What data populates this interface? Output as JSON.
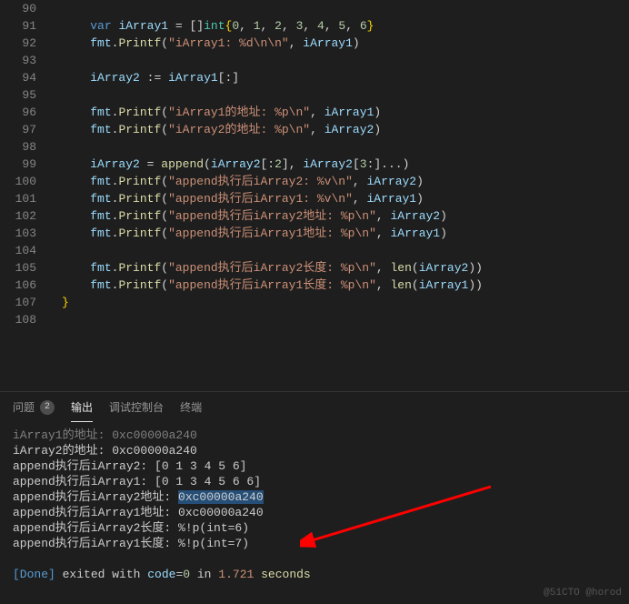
{
  "editor": {
    "lines": [
      {
        "n": 90,
        "html": ""
      },
      {
        "n": 91,
        "html": "    <span class='kw2'>var</span> <span class='ident'>iArray1</span> <span class='op'>=</span> <span class='op'>[]</span><span class='type'>int</span><span class='brace'>{</span><span class='num'>0</span>, <span class='num'>1</span>, <span class='num'>2</span>, <span class='num'>3</span>, <span class='num'>4</span>, <span class='num'>5</span>, <span class='num'>6</span><span class='brace'>}</span>"
      },
      {
        "n": 92,
        "html": "    <span class='ident'>fmt</span>.<span class='func'>Printf</span>(<span class='str'>\"iArray1: %d\\n\\n\"</span>, <span class='ident'>iArray1</span>)"
      },
      {
        "n": 93,
        "html": ""
      },
      {
        "n": 94,
        "html": "    <span class='ident'>iArray2</span> <span class='op'>:=</span> <span class='ident'>iArray1</span>[:]"
      },
      {
        "n": 95,
        "html": ""
      },
      {
        "n": 96,
        "html": "    <span class='ident'>fmt</span>.<span class='func'>Printf</span>(<span class='str'>\"iArray1的地址: %p\\n\"</span>, <span class='ident'>iArray1</span>)"
      },
      {
        "n": 97,
        "html": "    <span class='ident'>fmt</span>.<span class='func'>Printf</span>(<span class='str'>\"iArray2的地址: %p\\n\"</span>, <span class='ident'>iArray2</span>)"
      },
      {
        "n": 98,
        "html": ""
      },
      {
        "n": 99,
        "html": "    <span class='ident'>iArray2</span> <span class='op'>=</span> <span class='func'>append</span>(<span class='ident'>iArray2</span>[:<span class='num'>2</span>], <span class='ident'>iArray2</span>[<span class='num'>3</span>:]<span class='op'>...</span>)"
      },
      {
        "n": 100,
        "html": "    <span class='ident'>fmt</span>.<span class='func'>Printf</span>(<span class='str'>\"append执行后iArray2: %v\\n\"</span>, <span class='ident'>iArray2</span>)"
      },
      {
        "n": 101,
        "html": "    <span class='ident'>fmt</span>.<span class='func'>Printf</span>(<span class='str'>\"append执行后iArray1: %v\\n\"</span>, <span class='ident'>iArray1</span>)"
      },
      {
        "n": 102,
        "html": "    <span class='ident'>fmt</span>.<span class='func'>Printf</span>(<span class='str'>\"append执行后iArray2地址: %p\\n\"</span>, <span class='ident'>iArray2</span>)"
      },
      {
        "n": 103,
        "html": "    <span class='ident'>fmt</span>.<span class='func'>Printf</span>(<span class='str'>\"append执行后iArray1地址: %p\\n\"</span>, <span class='ident'>iArray1</span>)"
      },
      {
        "n": 104,
        "html": ""
      },
      {
        "n": 105,
        "html": "    <span class='ident'>fmt</span>.<span class='func'>Printf</span>(<span class='str'>\"append执行后iArray2长度: %p\\n\"</span>, <span class='func'>len</span>(<span class='ident'>iArray2</span>))"
      },
      {
        "n": 106,
        "html": "    <span class='ident'>fmt</span>.<span class='func'>Printf</span>(<span class='str'>\"append执行后iArray1长度: %p\\n\"</span>, <span class='func'>len</span>(<span class='ident'>iArray1</span>))"
      },
      {
        "n": 107,
        "html": "<span class='brace'>}</span>"
      },
      {
        "n": 108,
        "html": ""
      }
    ]
  },
  "panel": {
    "tabs": {
      "problems": "问题",
      "problems_count": "2",
      "output": "输出",
      "debug": "调试控制台",
      "terminal": "终端"
    },
    "output_lines": [
      {
        "html": "<span class='dim'>iArray1的地址: 0xc00000a240</span>"
      },
      {
        "html": "iArray2的地址: 0xc00000a240"
      },
      {
        "html": "append执行后iArray2: [0 1 3 4 5 6]"
      },
      {
        "html": "append执行后iArray1: [0 1 3 4 5 6 6]"
      },
      {
        "html": "append执行后iArray2地址: <span class='hl'>0xc00000a240</span>"
      },
      {
        "html": "append执行后iArray1地址: 0xc00000a240"
      },
      {
        "html": "append执行后iArray2长度: %!p(int=6)"
      },
      {
        "html": "append执行后iArray1长度: %!p(int=7)"
      },
      {
        "html": ""
      },
      {
        "html": "<span class='done'>[Done]</span> exited with <span class='ident'>code</span>=<span class='code0'>0</span> in <span class='time'>1.721</span> <span class='sec'>seconds</span>"
      }
    ]
  },
  "watermark": "@51CTO @horod"
}
